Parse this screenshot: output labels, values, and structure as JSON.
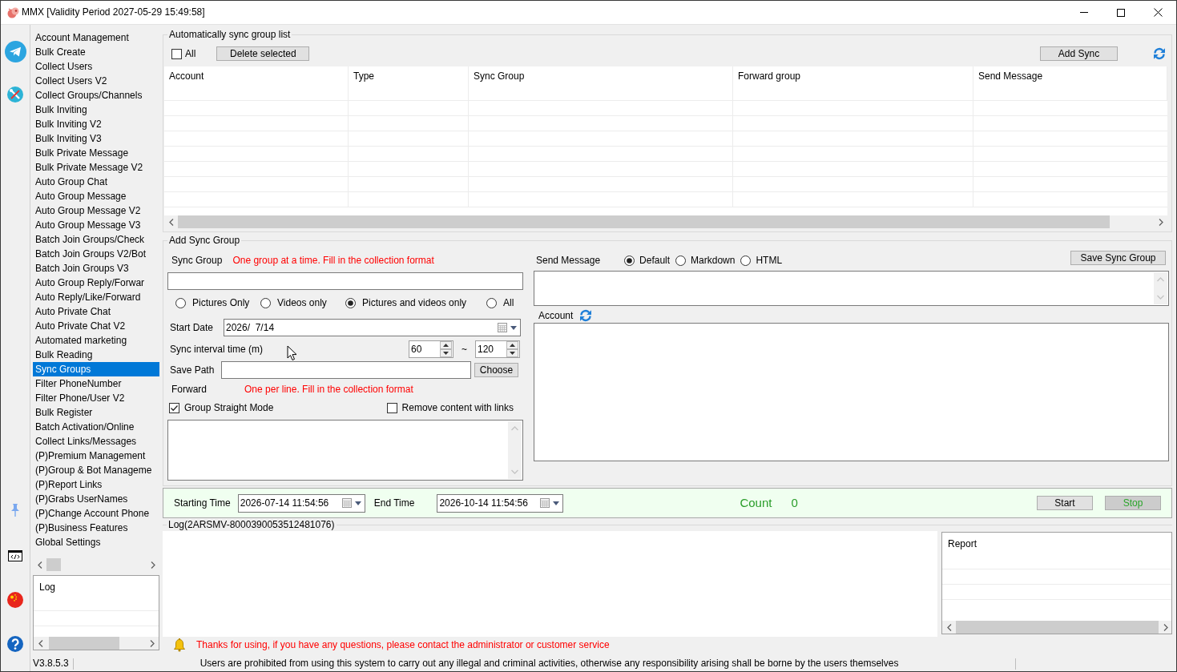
{
  "window": {
    "title": "MMX [Validity Period 2027-05-29 15:49:58]"
  },
  "sidebar": {
    "items": [
      {
        "label": "Account Management",
        "selected": false
      },
      {
        "label": "Bulk Create",
        "selected": false
      },
      {
        "label": "Collect Users",
        "selected": false
      },
      {
        "label": "Collect Users V2",
        "selected": false
      },
      {
        "label": "Collect Groups/Channels",
        "selected": false
      },
      {
        "label": "Bulk Inviting",
        "selected": false
      },
      {
        "label": "Bulk Inviting V2",
        "selected": false
      },
      {
        "label": "Bulk Inviting V3",
        "selected": false
      },
      {
        "label": "Bulk Private Message",
        "selected": false
      },
      {
        "label": "Bulk Private Message V2",
        "selected": false
      },
      {
        "label": "Auto Group Chat",
        "selected": false
      },
      {
        "label": "Auto Group Message",
        "selected": false
      },
      {
        "label": "Auto Group Message V2",
        "selected": false
      },
      {
        "label": "Auto Group Message V3",
        "selected": false
      },
      {
        "label": "Batch Join Groups/Check",
        "selected": false
      },
      {
        "label": "Batch Join Groups V2/Bot",
        "selected": false
      },
      {
        "label": "Batch Join Groups V3",
        "selected": false
      },
      {
        "label": "Auto Group Reply/Forwar",
        "selected": false
      },
      {
        "label": "Auto Reply/Like/Forward",
        "selected": false
      },
      {
        "label": "Auto Private Chat",
        "selected": false
      },
      {
        "label": "Auto Private Chat V2",
        "selected": false
      },
      {
        "label": "Automated marketing",
        "selected": false
      },
      {
        "label": "Bulk Reading",
        "selected": false
      },
      {
        "label": "Sync Groups",
        "selected": true
      },
      {
        "label": "Filter PhoneNumber",
        "selected": false
      },
      {
        "label": "Filter Phone/User V2",
        "selected": false
      },
      {
        "label": "Bulk Register",
        "selected": false
      },
      {
        "label": "Batch Activation/Online",
        "selected": false
      },
      {
        "label": "Collect Links/Messages",
        "selected": false
      },
      {
        "label": "(P)Premium Management",
        "selected": false
      },
      {
        "label": "(P)Group & Bot Manageme",
        "selected": false
      },
      {
        "label": "(P)Report Links",
        "selected": false
      },
      {
        "label": "(P)Grabs UserNames",
        "selected": false
      },
      {
        "label": "(P)Change Account Phone",
        "selected": false
      },
      {
        "label": "(P)Business Features",
        "selected": false
      },
      {
        "label": "Global Settings",
        "selected": false
      }
    ],
    "log_list": {
      "header": "Log"
    }
  },
  "sync_list": {
    "title": "Automatically sync group list",
    "select_all": {
      "label": "All",
      "checked": false
    },
    "delete_button": "Delete selected",
    "add_button": "Add Sync",
    "columns": [
      "Account",
      "Type",
      "Sync Group",
      "Forward group",
      "Send Message"
    ]
  },
  "add_sync_group": {
    "title": "Add Sync Group",
    "sync_group": {
      "label": "Sync Group",
      "hint": "One group at a time. Fill in the collection format"
    },
    "media_types": [
      {
        "label": "Pictures Only",
        "selected": false
      },
      {
        "label": "Videos only",
        "selected": false
      },
      {
        "label": "Pictures and videos only",
        "selected": true
      },
      {
        "label": "All",
        "selected": false
      }
    ],
    "start_date": {
      "label": "Start Date",
      "value": "2026/  7/14"
    },
    "sync_interval": {
      "label": "Sync interval time (m)",
      "min": "60",
      "separator": "~",
      "max": "120"
    },
    "save_path": {
      "label": "Save Path",
      "button": "Choose"
    },
    "forward": {
      "label": "Forward",
      "hint": "One per line. Fill in the collection format"
    },
    "options": [
      {
        "label": "Group Straight Mode",
        "checked": true
      },
      {
        "label": "Remove content with links",
        "checked": false
      }
    ],
    "send_message": {
      "label": "Send Message",
      "formats": [
        {
          "label": "Default",
          "selected": true
        },
        {
          "label": "Markdown",
          "selected": false
        },
        {
          "label": "HTML",
          "selected": false
        }
      ]
    },
    "save_button": "Save Sync Group",
    "account": {
      "label": "Account"
    }
  },
  "run_bar": {
    "start_label": "Starting Time",
    "start_value": "2026-07-14 11:54:56",
    "end_label": "End Time",
    "end_value": "2026-10-14 11:54:56",
    "count_label": "Count",
    "count_value": "0",
    "start_button": "Start",
    "stop_button": "Stop"
  },
  "log": {
    "title": "Log(2ARSMV-8000390053512481076)",
    "report_header": "Report"
  },
  "notice": "Thanks for using, if you have any questions, please contact the administrator or customer service",
  "status_bar": {
    "version": "V3.8.5.3",
    "disclaimer": "Users are prohibited from using this system to carry out any illegal and criminal activities, otherwise any responsibility arising shall be borne by the users themselves"
  }
}
